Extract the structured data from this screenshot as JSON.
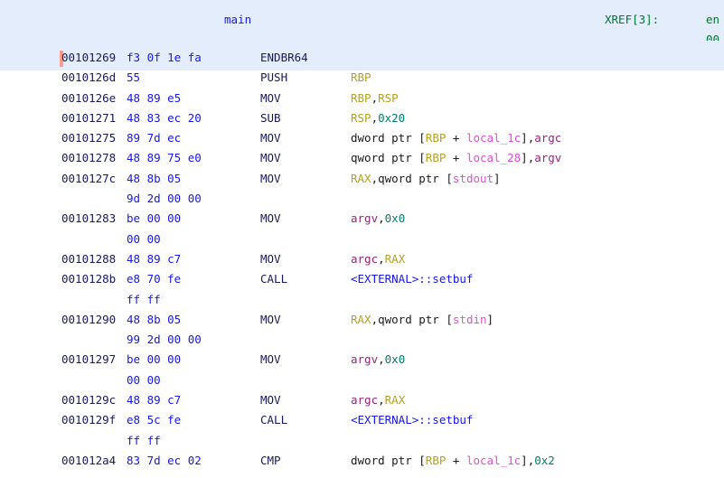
{
  "window": {
    "app": "ghidra-listing",
    "view_title": "Listing"
  },
  "header": {
    "function_label": "main",
    "xref_label": "XREF[3]:",
    "xref_target": "en",
    "xref_address": "00"
  },
  "cursor": {
    "at_address": "00101269",
    "marker_color": "#fb9b94",
    "row_highlight_color": "#e4edfb"
  },
  "colors": {
    "background": "#ffffff",
    "highlight_band": "#e4edfb",
    "address": "#19195c",
    "bytes": "#1616f0",
    "mnemonic": "#19195c",
    "register": "#b5a11f",
    "local_var": "#e050d8",
    "parameter": "#96287a",
    "constant": "#00806b",
    "external_symbol": "#1616f0",
    "function_name": "#1616f0",
    "xref": "#007733"
  },
  "listing": {
    "columns": [
      "address",
      "bytes",
      "mnemonic",
      "operands"
    ],
    "rows": [
      {
        "address": "00101269",
        "bytes": "f3 0f 1e fa",
        "mnemonic": "ENDBR64",
        "operands": [],
        "highlighted": true
      },
      {
        "address": "0010126d",
        "bytes": "55",
        "mnemonic": "PUSH",
        "operands": [
          {
            "t": "reg",
            "v": "RBP"
          }
        ]
      },
      {
        "address": "0010126e",
        "bytes": "48 89 e5",
        "mnemonic": "MOV",
        "operands": [
          {
            "t": "reg",
            "v": "RBP"
          },
          {
            "t": "plain",
            "v": ","
          },
          {
            "t": "reg",
            "v": "RSP"
          }
        ]
      },
      {
        "address": "00101271",
        "bytes": "48 83 ec 20",
        "mnemonic": "SUB",
        "operands": [
          {
            "t": "reg",
            "v": "RSP"
          },
          {
            "t": "plain",
            "v": ","
          },
          {
            "t": "const",
            "v": "0x20"
          }
        ]
      },
      {
        "address": "00101275",
        "bytes": "89 7d ec",
        "mnemonic": "MOV",
        "operands": [
          {
            "t": "plain",
            "v": "dword ptr ["
          },
          {
            "t": "reg",
            "v": "RBP"
          },
          {
            "t": "plain",
            "v": " + "
          },
          {
            "t": "var",
            "v": "local_1c"
          },
          {
            "t": "plain",
            "v": "],"
          },
          {
            "t": "param",
            "v": "argc"
          }
        ]
      },
      {
        "address": "00101278",
        "bytes": "48 89 75 e0",
        "mnemonic": "MOV",
        "operands": [
          {
            "t": "plain",
            "v": "qword ptr ["
          },
          {
            "t": "reg",
            "v": "RBP"
          },
          {
            "t": "plain",
            "v": " + "
          },
          {
            "t": "var",
            "v": "local_28"
          },
          {
            "t": "plain",
            "v": "],"
          },
          {
            "t": "param",
            "v": "argv"
          }
        ]
      },
      {
        "address": "0010127c",
        "bytes": "48 8b 05",
        "mnemonic": "MOV",
        "operands": [
          {
            "t": "reg",
            "v": "RAX"
          },
          {
            "t": "plain",
            "v": ",qword ptr ["
          },
          {
            "t": "sym",
            "v": "stdout"
          },
          {
            "t": "plain",
            "v": "]"
          }
        ]
      },
      {
        "address": "",
        "bytes": "9d 2d 00 00",
        "mnemonic": "",
        "operands": []
      },
      {
        "address": "00101283",
        "bytes": "be 00 00",
        "mnemonic": "MOV",
        "operands": [
          {
            "t": "param",
            "v": "argv"
          },
          {
            "t": "plain",
            "v": ","
          },
          {
            "t": "const",
            "v": "0x0"
          }
        ]
      },
      {
        "address": "",
        "bytes": "00 00",
        "mnemonic": "",
        "operands": []
      },
      {
        "address": "00101288",
        "bytes": "48 89 c7",
        "mnemonic": "MOV",
        "operands": [
          {
            "t": "param",
            "v": "argc"
          },
          {
            "t": "plain",
            "v": ","
          },
          {
            "t": "reg",
            "v": "RAX"
          }
        ]
      },
      {
        "address": "0010128b",
        "bytes": "e8 70 fe",
        "mnemonic": "CALL",
        "operands": [
          {
            "t": "extcall",
            "v": "<EXTERNAL>::setbuf"
          }
        ]
      },
      {
        "address": "",
        "bytes": "ff ff",
        "mnemonic": "",
        "operands": []
      },
      {
        "address": "00101290",
        "bytes": "48 8b 05",
        "mnemonic": "MOV",
        "operands": [
          {
            "t": "reg",
            "v": "RAX"
          },
          {
            "t": "plain",
            "v": ",qword ptr ["
          },
          {
            "t": "sym",
            "v": "stdin"
          },
          {
            "t": "plain",
            "v": "]"
          }
        ]
      },
      {
        "address": "",
        "bytes": "99 2d 00 00",
        "mnemonic": "",
        "operands": []
      },
      {
        "address": "00101297",
        "bytes": "be 00 00",
        "mnemonic": "MOV",
        "operands": [
          {
            "t": "param",
            "v": "argv"
          },
          {
            "t": "plain",
            "v": ","
          },
          {
            "t": "const",
            "v": "0x0"
          }
        ]
      },
      {
        "address": "",
        "bytes": "00 00",
        "mnemonic": "",
        "operands": []
      },
      {
        "address": "0010129c",
        "bytes": "48 89 c7",
        "mnemonic": "MOV",
        "operands": [
          {
            "t": "param",
            "v": "argc"
          },
          {
            "t": "plain",
            "v": ","
          },
          {
            "t": "reg",
            "v": "RAX"
          }
        ]
      },
      {
        "address": "0010129f",
        "bytes": "e8 5c fe",
        "mnemonic": "CALL",
        "operands": [
          {
            "t": "extcall",
            "v": "<EXTERNAL>::setbuf"
          }
        ]
      },
      {
        "address": "",
        "bytes": "ff ff",
        "mnemonic": "",
        "operands": []
      },
      {
        "address": "001012a4",
        "bytes": "83 7d ec 02",
        "mnemonic": "CMP",
        "operands": [
          {
            "t": "plain",
            "v": "dword ptr ["
          },
          {
            "t": "reg",
            "v": "RBP"
          },
          {
            "t": "plain",
            "v": " + "
          },
          {
            "t": "var",
            "v": "local_1c"
          },
          {
            "t": "plain",
            "v": "],"
          },
          {
            "t": "const",
            "v": "0x2"
          }
        ]
      }
    ]
  }
}
